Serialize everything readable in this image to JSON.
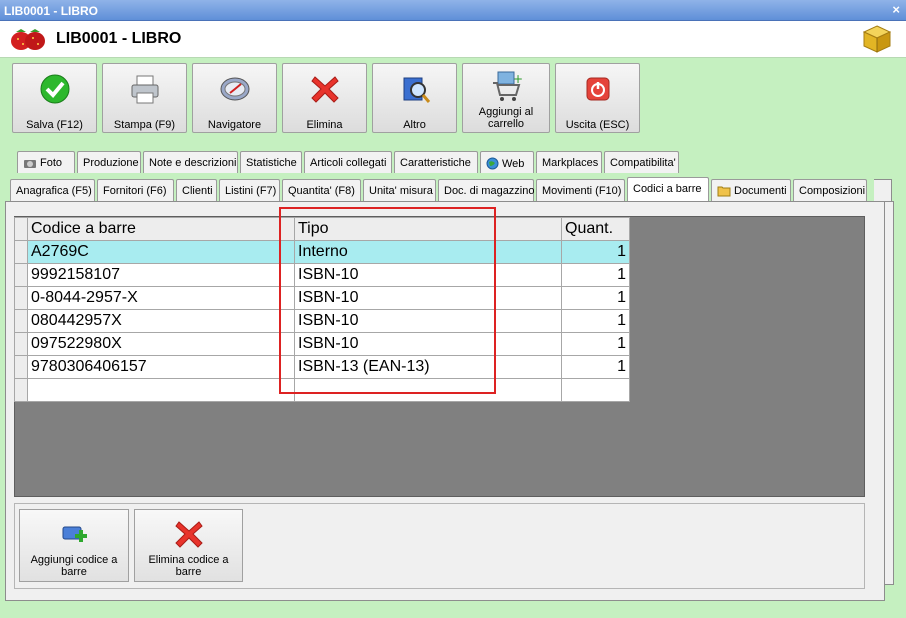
{
  "window": {
    "title": "LIB0001 - LIBRO",
    "close_glyph": "×"
  },
  "header": {
    "title": "LIB0001 - LIBRO",
    "app_icon": "strawberry-icon",
    "right_icon": "boxes-icon"
  },
  "toolbar": {
    "save": "Salva (F12)",
    "print": "Stampa (F9)",
    "navigator": "Navigatore",
    "delete": "Elimina",
    "other": "Altro",
    "cart_line1": "Aggiungi al",
    "cart_line2": "carrello",
    "exit": "Uscita (ESC)"
  },
  "tabs_row1": {
    "photo": "Foto",
    "production": "Produzione",
    "notes": "Note e descrizioni",
    "stats": "Statistiche",
    "linked": "Articoli collegati",
    "features": "Caratteristiche",
    "web": "Web",
    "marketplaces": "Markplaces",
    "compat": "Compatibilita'"
  },
  "tabs_row2": {
    "registry": "Anagrafica (F5)",
    "suppliers": "Fornitori (F6)",
    "customers": "Clienti",
    "pricelists": "Listini (F7)",
    "quantity": "Quantita' (F8)",
    "unit": "Unita' misura",
    "warehouse_docs": "Doc. di magazzino",
    "movements": "Movimenti (F10)",
    "barcodes": "Codici a barre",
    "documents": "Documenti",
    "compositions": "Composizioni"
  },
  "active_tab": "Codici a barre",
  "grid": {
    "headers": {
      "code": "Codice a barre",
      "type": "Tipo",
      "qty": "Quant."
    },
    "rows": [
      {
        "code": "A2769C",
        "type": "Interno",
        "qty": "1"
      },
      {
        "code": "9992158107",
        "type": "ISBN-10",
        "qty": "1"
      },
      {
        "code": "0-8044-2957-X",
        "type": "ISBN-10",
        "qty": "1"
      },
      {
        "code": "080442957X",
        "type": "ISBN-10",
        "qty": "1"
      },
      {
        "code": "097522980X",
        "type": "ISBN-10",
        "qty": "1"
      },
      {
        "code": "9780306406157",
        "type": "ISBN-13 (EAN-13)",
        "qty": "1"
      }
    ],
    "selected_row_color": "#a8ecf0"
  },
  "bottom": {
    "add_line1": "Aggiungi codice a",
    "add_line2": "barre",
    "del_line1": "Elimina codice a",
    "del_line2": "barre"
  },
  "colors": {
    "background": "#c5f0c0",
    "highlight": "#dd2222",
    "title_bar": "#5f8fd8"
  }
}
